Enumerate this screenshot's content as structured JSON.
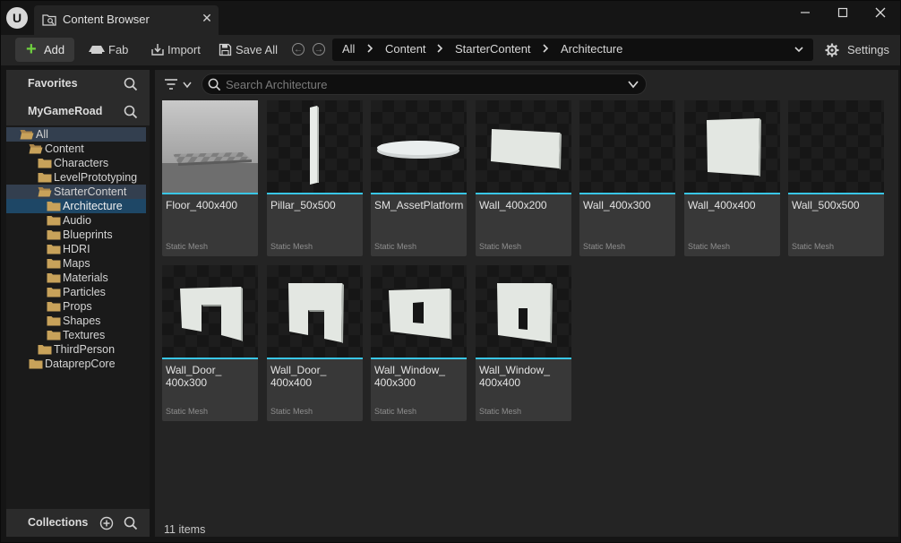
{
  "window": {
    "tab_title": "Content Browser",
    "logo_text": "U",
    "controls": [
      "minimize",
      "maximize",
      "close"
    ]
  },
  "toolbar": {
    "add_label": "Add",
    "fab_label": "Fab",
    "import_label": "Import",
    "save_all_label": "Save All",
    "settings_label": "Settings"
  },
  "breadcrumb": [
    "All",
    "Content",
    "StarterContent",
    "Architecture"
  ],
  "left": {
    "favorites_label": "Favorites",
    "project_label": "MyGameRoad",
    "collections_label": "Collections",
    "tree": [
      {
        "label": "All",
        "level": 0,
        "expanded": true
      },
      {
        "label": "Content",
        "level": 1,
        "expanded": true
      },
      {
        "label": "Characters",
        "level": 2,
        "expanded": false
      },
      {
        "label": "LevelPrototyping",
        "level": 2,
        "expanded": false
      },
      {
        "label": "StarterContent",
        "level": 2,
        "expanded": true
      },
      {
        "label": "Architecture",
        "level": 3,
        "selected": true
      },
      {
        "label": "Audio",
        "level": 3
      },
      {
        "label": "Blueprints",
        "level": 3,
        "expanded": false
      },
      {
        "label": "HDRI",
        "level": 3
      },
      {
        "label": "Maps",
        "level": 3
      },
      {
        "label": "Materials",
        "level": 3
      },
      {
        "label": "Particles",
        "level": 3,
        "expanded": false
      },
      {
        "label": "Props",
        "level": 3,
        "expanded": false
      },
      {
        "label": "Shapes",
        "level": 3
      },
      {
        "label": "Textures",
        "level": 3
      },
      {
        "label": "ThirdPerson",
        "level": 2,
        "expanded": false
      },
      {
        "label": "DataprepCore",
        "level": 1
      }
    ]
  },
  "search": {
    "placeholder": "Search Architecture"
  },
  "assets": [
    {
      "name": "Floor_400x400",
      "type": "Static Mesh",
      "shape": "floor"
    },
    {
      "name": "Pillar_50x500",
      "type": "Static Mesh",
      "shape": "pillar"
    },
    {
      "name": "SM_AssetPlatform",
      "type": "Static Mesh",
      "shape": "platform"
    },
    {
      "name": "Wall_400x200",
      "type": "Static Mesh",
      "shape": "wall-wide"
    },
    {
      "name": "Wall_400x300",
      "type": "Static Mesh",
      "shape": "none"
    },
    {
      "name": "Wall_400x400",
      "type": "Static Mesh",
      "shape": "wall-square"
    },
    {
      "name": "Wall_500x500",
      "type": "Static Mesh",
      "shape": "none"
    },
    {
      "name": "Wall_Door_ 400x300",
      "type": "Static Mesh",
      "shape": "door"
    },
    {
      "name": "Wall_Door_ 400x400",
      "type": "Static Mesh",
      "shape": "door-tall"
    },
    {
      "name": "Wall_Window_ 400x300",
      "type": "Static Mesh",
      "shape": "window"
    },
    {
      "name": "Wall_Window_ 400x400",
      "type": "Static Mesh",
      "shape": "window-tall"
    }
  ],
  "status": {
    "item_count": "11 items"
  },
  "colors": {
    "accent": "#39c6e6",
    "add_green": "#6fcf3f",
    "selection": "#1e4766",
    "folder": "#c8a25a"
  }
}
